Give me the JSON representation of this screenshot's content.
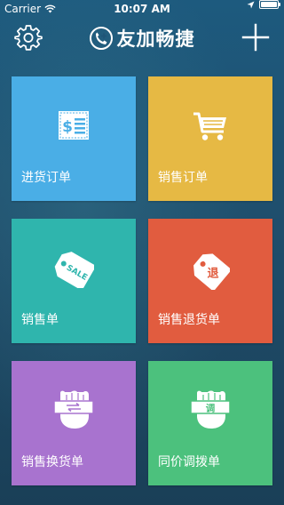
{
  "statusbar": {
    "carrier": "Carrier",
    "time": "10:07 AM",
    "battery_level": 1.0
  },
  "navbar": {
    "title": "友加畅捷",
    "settings_icon": "gear-icon",
    "add_icon": "plus-icon",
    "logo_icon": "phone-logo-icon"
  },
  "tiles": [
    {
      "label": "进货订单",
      "icon": "receipt-dollar-icon",
      "color": "#4aaee6"
    },
    {
      "label": "销售订单",
      "icon": "shopping-cart-icon",
      "color": "#e6b944"
    },
    {
      "label": "销售单",
      "icon": "sale-tag-icon",
      "color": "#2fb5ad",
      "icon_text": "SALE"
    },
    {
      "label": "销售退货单",
      "icon": "return-tag-icon",
      "color": "#e15c3f",
      "icon_text": "退"
    },
    {
      "label": "销售换货单",
      "icon": "exchange-hand-icon",
      "color": "#a873cf"
    },
    {
      "label": "同价调拨单",
      "icon": "transfer-hand-icon",
      "color": "#4cc17d",
      "icon_text": "调"
    }
  ]
}
